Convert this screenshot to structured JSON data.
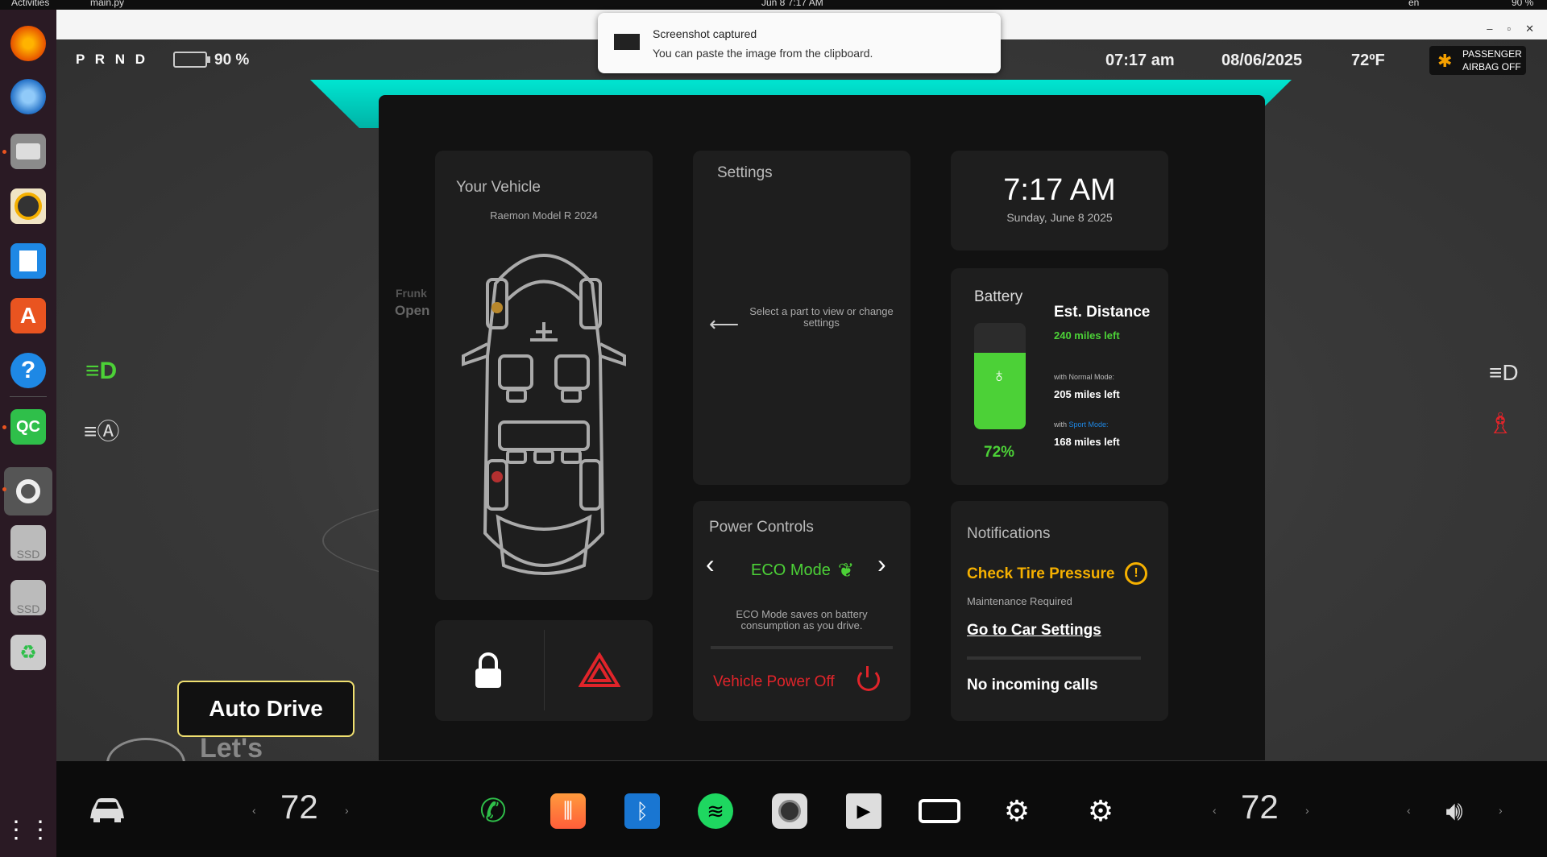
{
  "system": {
    "activities": "Activities",
    "app_name": "main.py",
    "clock": "Jun 8  7:17 AM",
    "locale": "en",
    "battery": "90 %"
  },
  "toast": {
    "title": "Screenshot captured",
    "body": "You can paste the image from the clipboard."
  },
  "header": {
    "gears": "P R N D",
    "battery_pct": "90 %",
    "time": "07:17 am",
    "date": "08/06/2025",
    "temperature": "72ºF",
    "airbag_line1": "PASSENGER",
    "airbag_line2": "AIRBAG OFF"
  },
  "vehicle": {
    "title": "Your Vehicle",
    "model": "Raemon Model R 2024",
    "frunk": "Frunk",
    "frunk_state": "Open"
  },
  "settings": {
    "title": "Settings",
    "hint": "Select a part to view or change settings"
  },
  "clock_card": {
    "time": "7:17 AM",
    "date": "Sunday, June 8 2025"
  },
  "battery": {
    "title": "Battery",
    "level": 72,
    "level_text": "72%",
    "est_title": "Est. Distance",
    "est_value": "240 miles left",
    "normal_prefix": "with",
    "normal_label": "Normal Mode:",
    "normal_value": "205 miles left",
    "sport_prefix": "with",
    "sport_label": "Sport Mode:",
    "sport_value": "168 miles left"
  },
  "power": {
    "title": "Power Controls",
    "mode": "ECO Mode",
    "desc": "ECO Mode saves on battery consumption as you drive.",
    "power_off": "Vehicle Power Off"
  },
  "notifications": {
    "title": "Notifications",
    "alert": "Check Tire Pressure",
    "sub": "Maintenance Required",
    "link": "Go to Car Settings",
    "calls": "No incoming calls"
  },
  "auto_drive": {
    "label": "Auto Drive",
    "sub": "Let's"
  },
  "bottom": {
    "temp_left": "72",
    "temp_right": "72"
  },
  "colors": {
    "accent_teal": "#00d8c6",
    "green": "#4cd137",
    "red": "#e0242a",
    "amber": "#f5b000"
  }
}
